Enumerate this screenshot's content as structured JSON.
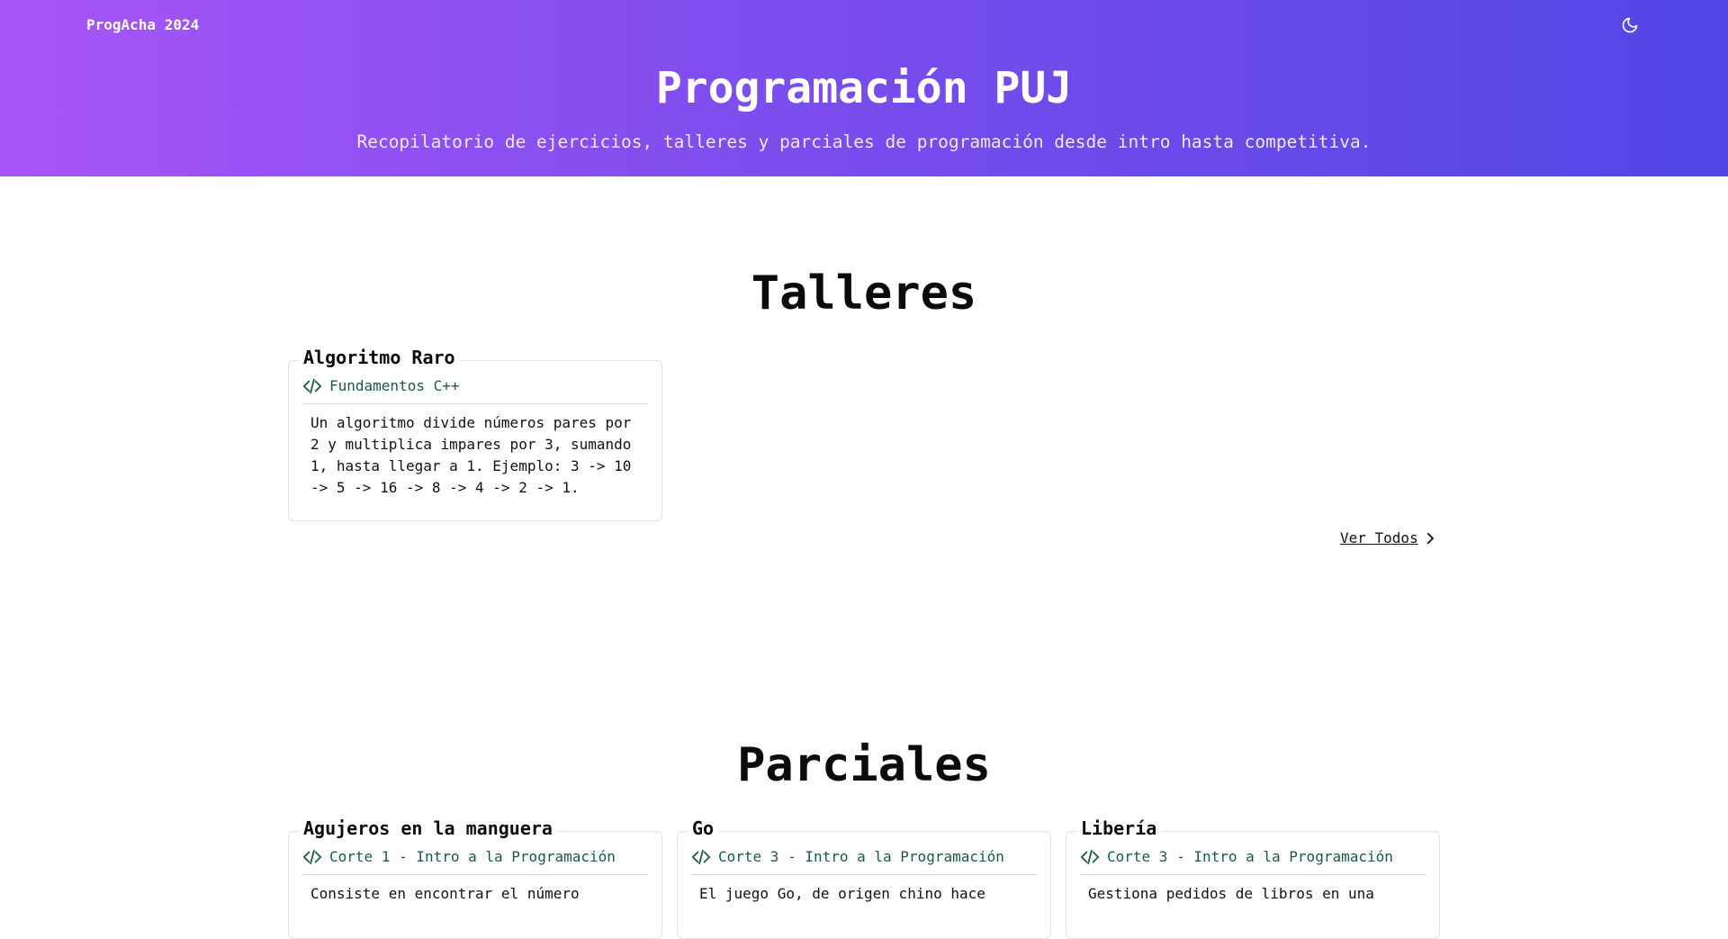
{
  "header": {
    "brand": "ProgAcha 2024",
    "theme_toggle_icon": "moon-icon",
    "title": "Programación PUJ",
    "subtitle": "Recopilatorio de ejercicios, talleres y parciales de programación desde intro hasta competitiva."
  },
  "colors": {
    "gradient_start": "#a855f7",
    "gradient_end": "#5146e5",
    "tag_text": "#1a5a4a"
  },
  "talleres": {
    "heading": "Talleres",
    "cards": [
      {
        "title": "Algoritmo Raro",
        "tag": "Fundamentos C++",
        "tag_icon": "code-icon",
        "description": "Un algoritmo divide números pares por 2 y multiplica impares por 3, sumando 1, hasta llegar a 1. Ejemplo: 3 -> 10 -> 5 -> 16 -> 8 -> 4 -> 2 -> 1."
      }
    ],
    "see_all": "Ver Todos",
    "see_all_icon": "chevron-right-icon"
  },
  "parciales": {
    "heading": "Parciales",
    "cards": [
      {
        "title": "Agujeros en la manguera",
        "tag": "Corte 1 - Intro a la Programación",
        "tag_icon": "code-icon",
        "description": "Consiste en encontrar el número"
      },
      {
        "title": "Go",
        "tag": "Corte 3 - Intro a la Programación",
        "tag_icon": "code-icon",
        "description": "El juego Go, de origen chino hace"
      },
      {
        "title": "Libería",
        "tag": "Corte 3 - Intro a la Programación",
        "tag_icon": "code-icon",
        "description": "Gestiona pedidos de libros en una"
      }
    ]
  }
}
